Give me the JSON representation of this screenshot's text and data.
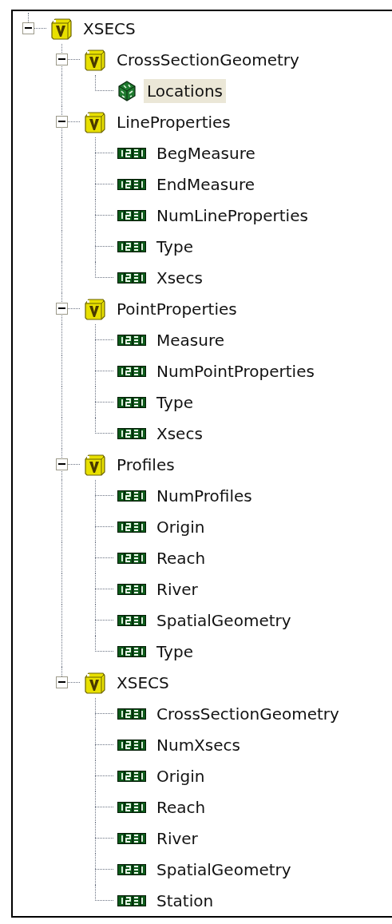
{
  "tree": [
    {
      "label": "XSECS",
      "kind": "folder",
      "expanded": true,
      "selected": false,
      "children": [
        {
          "label": "CrossSectionGeometry",
          "kind": "folder",
          "expanded": true,
          "selected": false,
          "children": [
            {
              "label": "Locations",
              "kind": "object",
              "selected": true
            }
          ]
        },
        {
          "label": "LineProperties",
          "kind": "folder",
          "expanded": true,
          "selected": false,
          "children": [
            {
              "label": "BegMeasure",
              "kind": "field",
              "selected": false
            },
            {
              "label": "EndMeasure",
              "kind": "field",
              "selected": false
            },
            {
              "label": "NumLineProperties",
              "kind": "field",
              "selected": false
            },
            {
              "label": "Type",
              "kind": "field",
              "selected": false
            },
            {
              "label": "Xsecs",
              "kind": "field",
              "selected": false
            }
          ]
        },
        {
          "label": "PointProperties",
          "kind": "folder",
          "expanded": true,
          "selected": false,
          "children": [
            {
              "label": "Measure",
              "kind": "field",
              "selected": false
            },
            {
              "label": "NumPointProperties",
              "kind": "field",
              "selected": false
            },
            {
              "label": "Type",
              "kind": "field",
              "selected": false
            },
            {
              "label": "Xsecs",
              "kind": "field",
              "selected": false
            }
          ]
        },
        {
          "label": "Profiles",
          "kind": "folder",
          "expanded": true,
          "selected": false,
          "children": [
            {
              "label": "NumProfiles",
              "kind": "field",
              "selected": false
            },
            {
              "label": "Origin",
              "kind": "field",
              "selected": false
            },
            {
              "label": "Reach",
              "kind": "field",
              "selected": false
            },
            {
              "label": "River",
              "kind": "field",
              "selected": false
            },
            {
              "label": "SpatialGeometry",
              "kind": "field",
              "selected": false
            },
            {
              "label": "Type",
              "kind": "field",
              "selected": false
            }
          ]
        },
        {
          "label": "XSECS",
          "kind": "folder",
          "expanded": true,
          "selected": false,
          "children": [
            {
              "label": "CrossSectionGeometry",
              "kind": "field",
              "selected": false
            },
            {
              "label": "NumXsecs",
              "kind": "field",
              "selected": false
            },
            {
              "label": "Origin",
              "kind": "field",
              "selected": false
            },
            {
              "label": "Reach",
              "kind": "field",
              "selected": false
            },
            {
              "label": "River",
              "kind": "field",
              "selected": false
            },
            {
              "label": "SpatialGeometry",
              "kind": "field",
              "selected": false
            },
            {
              "label": "Station",
              "kind": "field",
              "selected": false
            }
          ]
        }
      ]
    }
  ]
}
